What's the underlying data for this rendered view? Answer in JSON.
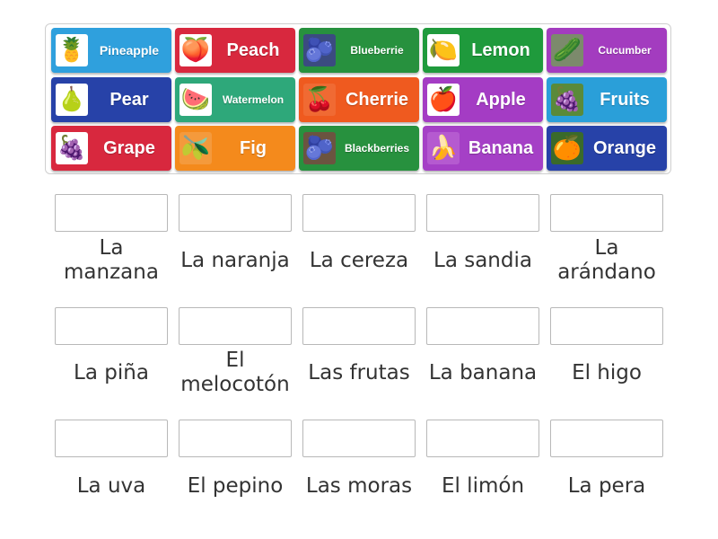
{
  "tiles": [
    {
      "label": "Pineapple",
      "color": "#2fa0dd",
      "icon": "pineapple-icon",
      "glyph": "🍍",
      "thumb_bg": "#ffffff",
      "size": "m"
    },
    {
      "label": "Peach",
      "color": "#d8283e",
      "icon": "peach-icon",
      "glyph": "🍑",
      "thumb_bg": "#ffffff",
      "size": "l"
    },
    {
      "label": "Blueberrie",
      "color": "#27913e",
      "icon": "blueberry-icon",
      "glyph": "🫐",
      "thumb_bg": "#3b4b80",
      "size": "s"
    },
    {
      "label": "Lemon",
      "color": "#1f9a3c",
      "icon": "lemon-icon",
      "glyph": "🍋",
      "thumb_bg": "#ffffff",
      "size": "l"
    },
    {
      "label": "Cucumber",
      "color": "#a33cbf",
      "icon": "cucumber-icon",
      "glyph": "🥒",
      "thumb_bg": "#7c8a6c",
      "size": "s"
    },
    {
      "label": "Pear",
      "color": "#2742a8",
      "icon": "pear-icon",
      "glyph": "🍐",
      "thumb_bg": "#ffffff",
      "size": "l"
    },
    {
      "label": "Watermelon",
      "color": "#2ea87a",
      "icon": "watermelon-icon",
      "glyph": "🍉",
      "thumb_bg": "#ffffff",
      "size": "s"
    },
    {
      "label": "Cherrie",
      "color": "#ef5a1f",
      "icon": "cherry-icon",
      "glyph": "🍒",
      "thumb_bg": "#f06a33",
      "size": "l"
    },
    {
      "label": "Apple",
      "color": "#a43cc4",
      "icon": "apple-icon",
      "glyph": "🍎",
      "thumb_bg": "#ffffff",
      "size": "l"
    },
    {
      "label": "Fruits",
      "color": "#2a9fd9",
      "icon": "fruits-icon",
      "glyph": "🍇",
      "thumb_bg": "#5a8a3a",
      "size": "l"
    },
    {
      "label": "Grape",
      "color": "#d8283e",
      "icon": "grape-icon",
      "glyph": "🍇",
      "thumb_bg": "#ffffff",
      "size": "l"
    },
    {
      "label": "Fig",
      "color": "#f48a1c",
      "icon": "fig-icon",
      "glyph": "🫒",
      "thumb_bg": "#f49a3c",
      "size": "l"
    },
    {
      "label": "Blackberries",
      "color": "#27913e",
      "icon": "blackberry-icon",
      "glyph": "🫐",
      "thumb_bg": "#6b5440",
      "size": "s"
    },
    {
      "label": "Banana",
      "color": "#a540c6",
      "icon": "banana-icon",
      "glyph": "🍌",
      "thumb_bg": "#b55ad0",
      "size": "l"
    },
    {
      "label": "Orange",
      "color": "#2742a8",
      "icon": "orange-icon",
      "glyph": "🍊",
      "thumb_bg": "#3a6a2a",
      "size": "l"
    }
  ],
  "words": [
    "La manzana",
    "La naranja",
    "La cereza",
    "La sandia",
    "La arándano",
    "La piña",
    "El melocotón",
    "Las frutas",
    "La banana",
    "El higo",
    "La uva",
    "El pepino",
    "Las moras",
    "El limón",
    "La pera"
  ]
}
